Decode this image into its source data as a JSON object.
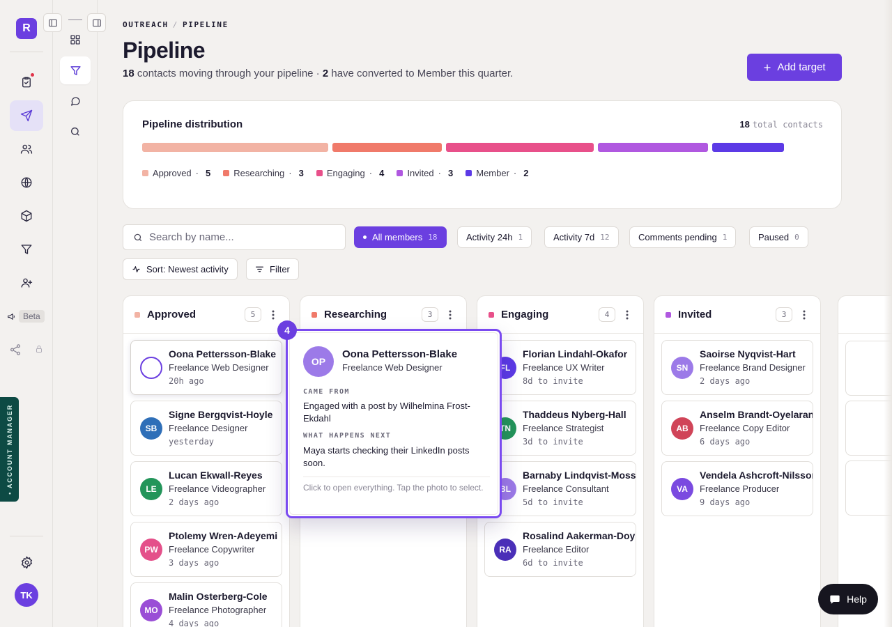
{
  "app": {
    "logo_letter": "R",
    "beta_label": "Beta",
    "account_manager_label": "• ACCOUNT MANAGER",
    "user_initials": "TK"
  },
  "breadcrumb": {
    "section": "OUTREACH",
    "page": "PIPELINE",
    "separator": "/"
  },
  "header": {
    "title": "Pipeline",
    "contacts_count": "18",
    "subtitle_mid": "contacts moving through your pipeline ·",
    "converted_count": "2",
    "subtitle_end": "have converted to Member this quarter.",
    "add_button": "Add target"
  },
  "distribution": {
    "title": "Pipeline distribution",
    "total": "18",
    "total_label": "total contacts",
    "stages": [
      {
        "name": "Approved",
        "count": "5",
        "value": 5,
        "color": "#f2b3a4"
      },
      {
        "name": "Researching",
        "count": "3",
        "value": 3,
        "color": "#f07a6a"
      },
      {
        "name": "Engaging",
        "count": "4",
        "value": 4,
        "color": "#e8508a"
      },
      {
        "name": "Invited",
        "count": "3",
        "value": 3,
        "color": "#b058e0"
      },
      {
        "name": "Member",
        "count": "2",
        "value": 2,
        "color": "#5c3ae6"
      }
    ]
  },
  "search": {
    "placeholder": "Search by name..."
  },
  "filters": [
    {
      "label": "All members",
      "count": "18",
      "active": true
    },
    {
      "label": "Activity 24h",
      "count": "1"
    },
    {
      "label": "Activity 7d",
      "count": "12"
    },
    {
      "label": "Comments pending",
      "count": "1"
    },
    {
      "label": "Paused",
      "count": "0"
    }
  ],
  "toolbar": {
    "sort_label": "Sort: Newest activity",
    "filter_label": "Filter"
  },
  "columns": [
    {
      "name": "Approved",
      "count": "5",
      "color": "#f2b3a4",
      "cards": [
        {
          "initials": "",
          "name": "Oona Pettersson-Blake",
          "role": "Freelance Web Designer",
          "time": "20h ago",
          "color": "#ffffff"
        },
        {
          "initials": "SB",
          "name": "Signe Bergqvist-Hoyle",
          "role": "Freelance Designer",
          "time": "yesterday",
          "color": "#2f6fb8"
        },
        {
          "initials": "LE",
          "name": "Lucan Ekwall-Reyes",
          "role": "Freelance Videographer",
          "time": "2 days ago",
          "color": "#23955a"
        },
        {
          "initials": "PW",
          "name": "Ptolemy Wren-Adeyemi",
          "role": "Freelance Copywriter",
          "time": "3 days ago",
          "color": "#e4508a"
        },
        {
          "initials": "MO",
          "name": "Malin Osterberg-Cole",
          "role": "Freelance Photographer",
          "time": "4 days ago",
          "color": "#9a4ed6"
        }
      ]
    },
    {
      "name": "Researching",
      "count": "3",
      "color": "#f07a6a",
      "cards": []
    },
    {
      "name": "Engaging",
      "count": "4",
      "color": "#e8508a",
      "cards": [
        {
          "initials": "FL",
          "name": "Florian Lindahl-Okafor",
          "role": "Freelance UX Writer",
          "time": "8d to invite",
          "color": "#5c3ae6"
        },
        {
          "initials": "TN",
          "name": "Thaddeus Nyberg-Hall",
          "role": "Freelance Strategist",
          "time": "3d to invite",
          "color": "#23955a"
        },
        {
          "initials": "BL",
          "name": "Barnaby Lindqvist-Moss",
          "role": "Freelance Consultant",
          "time": "5d to invite",
          "color": "#9c7ae8"
        },
        {
          "initials": "RA",
          "name": "Rosalind Aakerman-Doyle",
          "role": "Freelance Editor",
          "time": "6d to invite",
          "color": "#4a2fb8"
        }
      ]
    },
    {
      "name": "Invited",
      "count": "3",
      "color": "#b058e0",
      "cards": [
        {
          "initials": "SN",
          "name": "Saoirse Nyqvist-Hart",
          "role": "Freelance Brand Designer",
          "time": "2 days ago",
          "color": "#9c7ae8"
        },
        {
          "initials": "AB",
          "name": "Anselm Brandt-Oyelaran",
          "role": "Freelance Copy Editor",
          "time": "6 days ago",
          "color": "#d04458"
        },
        {
          "initials": "VA",
          "name": "Vendela Ashcroft-Nilsson",
          "role": "Freelance Producer",
          "time": "9 days ago",
          "color": "#7a4ae0"
        }
      ]
    }
  ],
  "popover": {
    "badge": "4",
    "initials": "OP",
    "name": "Oona Pettersson-Blake",
    "role": "Freelance Web Designer",
    "came_from_label": "CAME FROM",
    "came_from_text": "Engaged with a post by Wilhelmina Frost-Ekdahl",
    "next_label": "WHAT HAPPENS NEXT",
    "next_text": "Maya starts checking their LinkedIn posts soon.",
    "hint": "Click to open everything. Tap the photo to select."
  },
  "help": {
    "label": "Help"
  }
}
